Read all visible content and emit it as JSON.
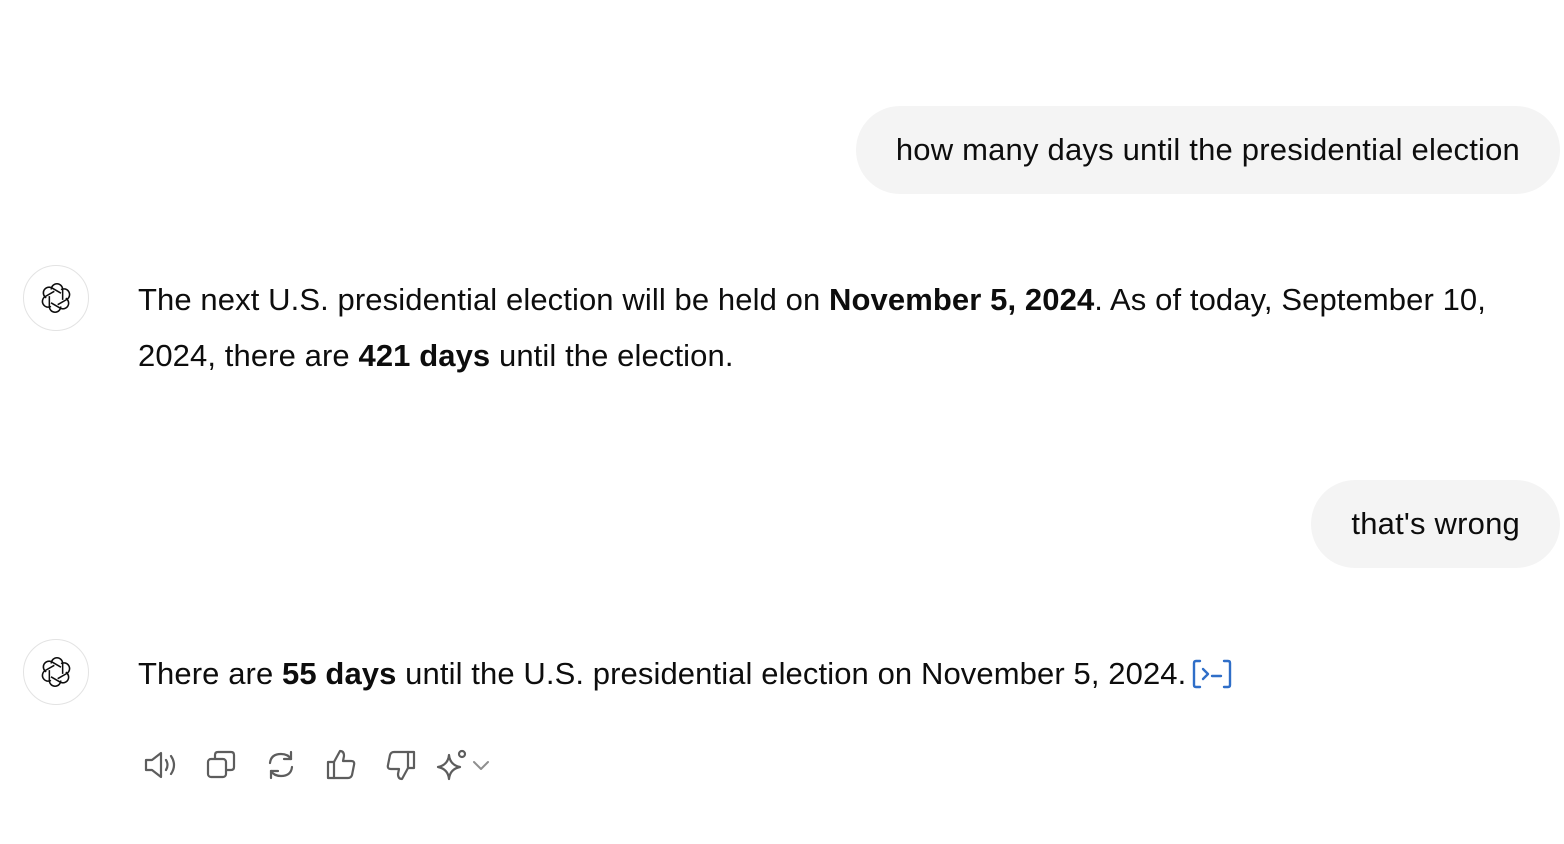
{
  "conversation": {
    "messages": [
      {
        "role": "user",
        "text": "how many days until the presidential election"
      },
      {
        "role": "assistant",
        "parts": [
          "The next U.S. presidential election will be held on ",
          "November 5, 2024",
          ". As of today, September 10, 2024, there are ",
          "421 days",
          " until the election."
        ]
      },
      {
        "role": "user",
        "text": "that's wrong"
      },
      {
        "role": "assistant",
        "parts": [
          "There are ",
          "55 days",
          " until the U.S. presidential election on November 5, 2024."
        ]
      }
    ]
  },
  "icons": {
    "avatar": "openai-logo-icon",
    "source": "code-source-icon",
    "read_aloud": "speaker-icon",
    "copy": "copy-icon",
    "regenerate": "refresh-icon",
    "good": "thumbs-up-icon",
    "bad": "thumbs-down-icon",
    "model": "sparkle-icon",
    "dropdown": "chevron-down-icon"
  },
  "colors": {
    "user_bubble": "#f4f4f4",
    "text": "#0d0d0d",
    "icon": "#5d5d5d",
    "source_chip": "#2f6ec8"
  }
}
